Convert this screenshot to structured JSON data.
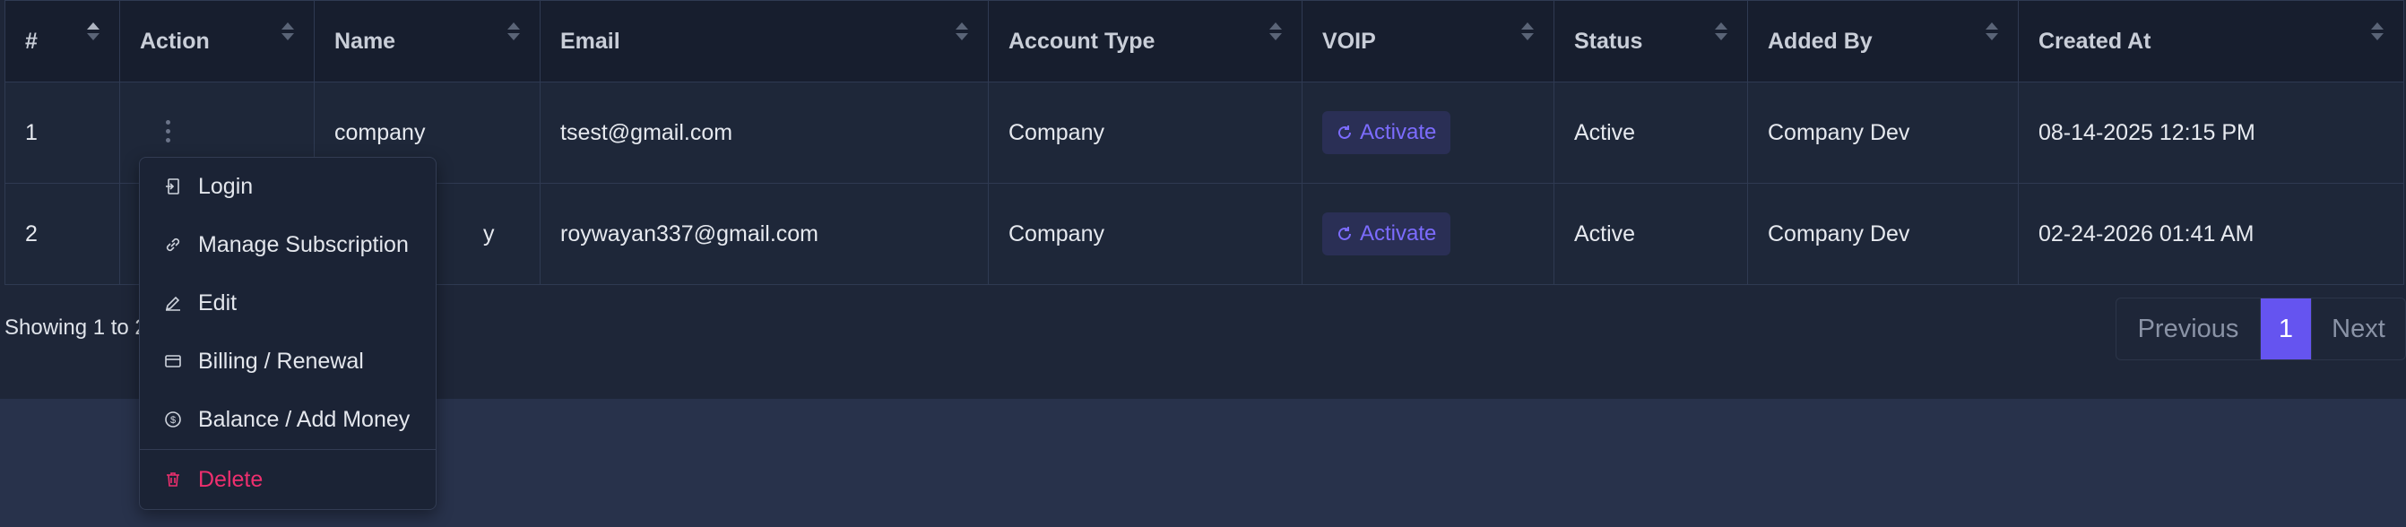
{
  "table": {
    "headers": [
      "#",
      "Action",
      "Name",
      "Email",
      "Account Type",
      "VOIP",
      "Status",
      "Added By",
      "Created At"
    ],
    "rows": [
      {
        "num": "1",
        "name": "company",
        "email": "tsest@gmail.com",
        "account_type": "Company",
        "voip": "Activate",
        "status": "Active",
        "added_by": "Company Dev",
        "created_at": "08-14-2025 12:15 PM"
      },
      {
        "num": "2",
        "name": "y",
        "email": "roywayan337@gmail.com",
        "account_type": "Company",
        "voip": "Activate",
        "status": "Active",
        "added_by": "Company Dev",
        "created_at": "02-24-2026 01:41 AM"
      }
    ]
  },
  "footer": {
    "showing": "Showing 1 to 2",
    "pagination": {
      "previous": "Previous",
      "current": "1",
      "next": "Next"
    }
  },
  "action_menu": {
    "items": [
      {
        "label": "Login",
        "icon": "login-icon"
      },
      {
        "label": "Manage Subscription",
        "icon": "link-icon"
      },
      {
        "label": "Edit",
        "icon": "pencil-icon"
      },
      {
        "label": "Billing / Renewal",
        "icon": "card-icon"
      },
      {
        "label": "Balance / Add Money",
        "icon": "dollar-circle-icon"
      }
    ],
    "delete": {
      "label": "Delete",
      "icon": "trash-icon"
    }
  },
  "colors": {
    "accent": "#6554f0",
    "danger": "#ee2f6e",
    "voip_text": "#7c6cff"
  }
}
